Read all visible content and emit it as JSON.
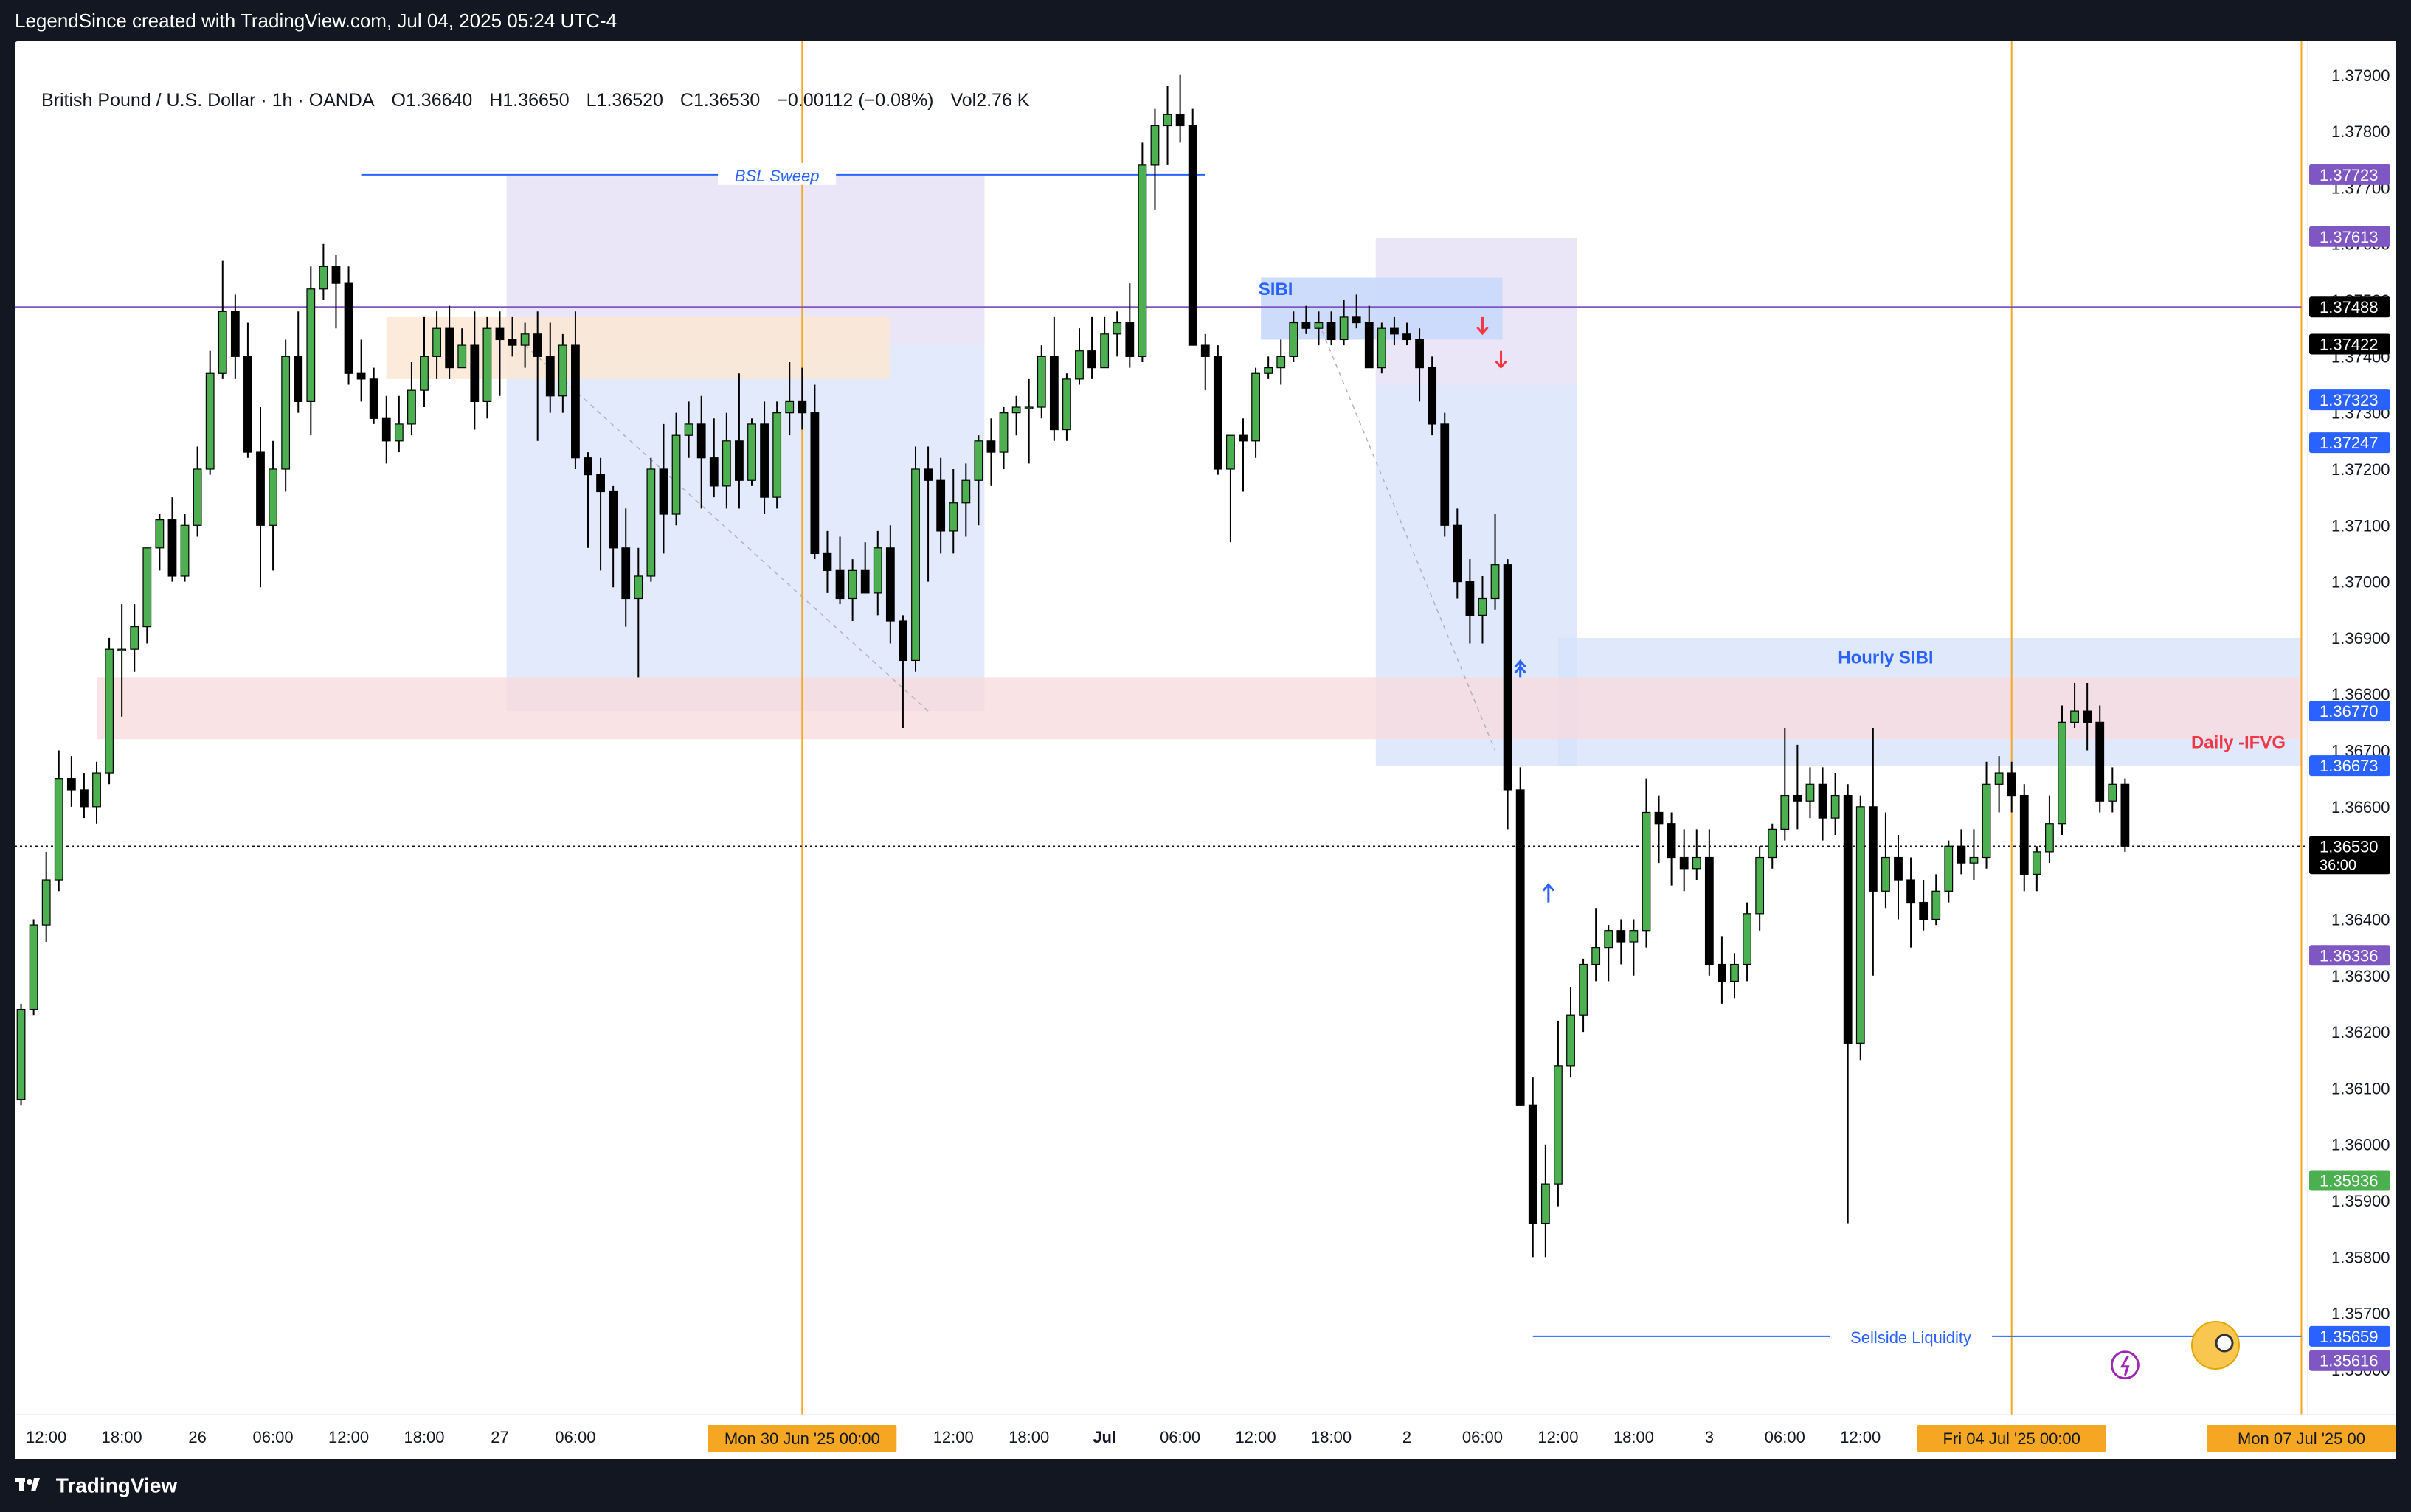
{
  "header": {
    "credit": "LegendSince created with TradingView.com, Jul 04, 2025 05:24 UTC-4"
  },
  "legend": {
    "symbol": "British Pound / U.S. Dollar · 1h · OANDA",
    "open": "O1.36640",
    "high": "H1.36650",
    "low": "L1.36520",
    "close": "C1.36530",
    "change": "−0.00112 (−0.08%)",
    "volume": "Vol2.76 K"
  },
  "footer": {
    "brand": "TradingView"
  },
  "colors": {
    "up": "#4caf50",
    "down": "#000000",
    "sibi_fill": "#d6e1fb",
    "purple_zone": "#ece6f6",
    "ifvg_fill": "#f8d9dc",
    "ob_fill": "#fbe7d3",
    "session_line": "#f5a623",
    "level_line": "#7e57c2",
    "blue_line": "#2962ff",
    "ifvg_text": "#f23645"
  },
  "chart_data": {
    "type": "candlestick",
    "title": "British Pound / U.S. Dollar · 1h · OANDA",
    "y_axis": {
      "range": [
        1.3552,
        1.3796
      ],
      "ticks": [
        "1.37900",
        "1.37800",
        "1.37700",
        "1.37600",
        "1.37500",
        "1.37400",
        "1.37300",
        "1.37200",
        "1.37100",
        "1.37000",
        "1.36900",
        "1.36800",
        "1.36700",
        "1.36600",
        "1.36500",
        "1.36400",
        "1.36300",
        "1.36200",
        "1.36100",
        "1.36000",
        "1.35900",
        "1.35800",
        "1.35700",
        "1.35600"
      ]
    },
    "x_axis": {
      "labels": [
        "12:00",
        "18:00",
        "26",
        "06:00",
        "12:00",
        "18:00",
        "27",
        "06:00",
        "12:00",
        "18:00",
        "Jul",
        "06:00",
        "12:00",
        "18:00",
        "2",
        "06:00",
        "12:00",
        "18:00",
        "3",
        "06:00",
        "12:00"
      ],
      "label_bars": [
        2,
        8,
        14,
        20,
        26,
        32,
        38,
        44,
        74,
        80,
        86,
        92,
        98,
        104,
        110,
        116,
        122,
        128,
        134,
        140,
        146
      ],
      "session_markers": [
        {
          "label": "Mon 30 Jun '25   00:00",
          "bar": 62
        },
        {
          "label": "Fri 04 Jul '25   00:00",
          "bar": 158
        },
        {
          "label": "Mon 07 Jul '25   00",
          "bar": 181
        }
      ]
    },
    "price_tags": [
      {
        "label": "1.37723",
        "value": 1.37723,
        "color": "#7e57c2"
      },
      {
        "label": "1.37613",
        "value": 1.37613,
        "color": "#7e57c2"
      },
      {
        "label": "1.37488",
        "value": 1.37488,
        "color": "#000000"
      },
      {
        "label": "1.37422",
        "value": 1.37422,
        "color": "#000000"
      },
      {
        "label": "1.37323",
        "value": 1.37323,
        "color": "#2962ff"
      },
      {
        "label": "1.37247",
        "value": 1.37247,
        "color": "#2962ff"
      },
      {
        "label": "1.36770",
        "value": 1.3677,
        "color": "#2962ff"
      },
      {
        "label": "1.36673",
        "value": 1.36673,
        "color": "#2962ff"
      },
      {
        "label": "1.36530",
        "value": 1.3653,
        "color": "#000000",
        "sub": "36:00"
      },
      {
        "label": "1.36336",
        "value": 1.36336,
        "color": "#7e57c2"
      },
      {
        "label": "1.35936",
        "value": 1.35936,
        "color": "#4caf50"
      },
      {
        "label": "1.35659",
        "value": 1.35659,
        "color": "#2962ff"
      },
      {
        "label": "1.35616",
        "value": 1.35616,
        "color": "#7e57c2"
      }
    ],
    "annotations": [
      {
        "text": "BSL Sweep",
        "price": 1.37723,
        "bar_from": 26,
        "bar_to": 90
      },
      {
        "text": "SIBI",
        "price": 1.3752,
        "bar": 99
      },
      {
        "text": "Hourly SIBI",
        "price": 1.36865,
        "bar": 148
      },
      {
        "text": "Daily -IFVG",
        "price": 1.36725,
        "bar": 181
      },
      {
        "text": "Sellside Liquidity",
        "price": 1.35659,
        "bar": 150
      }
    ],
    "candles": [
      [
        1.3608,
        1.3625,
        1.3607,
        1.3624
      ],
      [
        1.3624,
        1.364,
        1.3623,
        1.3639
      ],
      [
        1.3639,
        1.3652,
        1.3636,
        1.3647
      ],
      [
        1.3647,
        1.367,
        1.3645,
        1.3665
      ],
      [
        1.3665,
        1.3669,
        1.366,
        1.3663
      ],
      [
        1.3663,
        1.3666,
        1.3658,
        1.366
      ],
      [
        1.366,
        1.3668,
        1.3657,
        1.3666
      ],
      [
        1.3666,
        1.369,
        1.3664,
        1.3688
      ],
      [
        1.3688,
        1.3696,
        1.3676,
        1.3688
      ],
      [
        1.3688,
        1.3696,
        1.3684,
        1.3692
      ],
      [
        1.3692,
        1.3703,
        1.3689,
        1.3706
      ],
      [
        1.3706,
        1.3712,
        1.3702,
        1.3711
      ],
      [
        1.3711,
        1.3715,
        1.37,
        1.3701
      ],
      [
        1.3701,
        1.3712,
        1.37,
        1.371
      ],
      [
        1.371,
        1.3724,
        1.3708,
        1.372
      ],
      [
        1.372,
        1.3741,
        1.3719,
        1.3737
      ],
      [
        1.3737,
        1.3757,
        1.3736,
        1.3748
      ],
      [
        1.3748,
        1.3751,
        1.3736,
        1.374
      ],
      [
        1.374,
        1.3746,
        1.3722,
        1.3723
      ],
      [
        1.3723,
        1.3731,
        1.3699,
        1.371
      ],
      [
        1.371,
        1.3725,
        1.3702,
        1.372
      ],
      [
        1.372,
        1.3743,
        1.3716,
        1.374
      ],
      [
        1.374,
        1.3748,
        1.373,
        1.3732
      ],
      [
        1.3732,
        1.3756,
        1.3726,
        1.3752
      ],
      [
        1.3752,
        1.376,
        1.375,
        1.3756
      ],
      [
        1.3756,
        1.3758,
        1.3745,
        1.3753
      ],
      [
        1.3753,
        1.3756,
        1.3735,
        1.3737
      ],
      [
        1.3737,
        1.3743,
        1.3732,
        1.3736
      ],
      [
        1.3736,
        1.3738,
        1.3728,
        1.3729
      ],
      [
        1.3729,
        1.3733,
        1.3721,
        1.3725
      ],
      [
        1.3725,
        1.3733,
        1.3723,
        1.3728
      ],
      [
        1.3728,
        1.3739,
        1.3726,
        1.3734
      ],
      [
        1.3734,
        1.3747,
        1.3731,
        1.374
      ],
      [
        1.374,
        1.3748,
        1.3736,
        1.3745
      ],
      [
        1.3745,
        1.3749,
        1.3736,
        1.3738
      ],
      [
        1.3738,
        1.3745,
        1.3738,
        1.3742
      ],
      [
        1.3742,
        1.3748,
        1.3727,
        1.3732
      ],
      [
        1.3732,
        1.3747,
        1.3729,
        1.3745
      ],
      [
        1.3745,
        1.3748,
        1.3733,
        1.3743
      ],
      [
        1.3743,
        1.3747,
        1.374,
        1.3742
      ],
      [
        1.3742,
        1.3746,
        1.3738,
        1.3744
      ],
      [
        1.3744,
        1.3748,
        1.3725,
        1.374
      ],
      [
        1.374,
        1.3746,
        1.373,
        1.3733
      ],
      [
        1.3733,
        1.3744,
        1.373,
        1.3742
      ],
      [
        1.3742,
        1.3748,
        1.372,
        1.3722
      ],
      [
        1.3722,
        1.3723,
        1.3706,
        1.3719
      ],
      [
        1.3719,
        1.3722,
        1.3702,
        1.3716
      ],
      [
        1.3716,
        1.3717,
        1.3699,
        1.3706
      ],
      [
        1.3706,
        1.3713,
        1.3692,
        1.3697
      ],
      [
        1.3697,
        1.3706,
        1.3683,
        1.3701
      ],
      [
        1.3701,
        1.3722,
        1.37,
        1.372
      ],
      [
        1.372,
        1.3728,
        1.3705,
        1.3712
      ],
      [
        1.3712,
        1.373,
        1.371,
        1.3726
      ],
      [
        1.3726,
        1.3732,
        1.3722,
        1.3728
      ],
      [
        1.3728,
        1.3733,
        1.3713,
        1.3722
      ],
      [
        1.3722,
        1.3729,
        1.3715,
        1.3717
      ],
      [
        1.3717,
        1.373,
        1.3713,
        1.3725
      ],
      [
        1.3725,
        1.3737,
        1.3713,
        1.3718
      ],
      [
        1.3718,
        1.3729,
        1.3717,
        1.3728
      ],
      [
        1.3728,
        1.3732,
        1.3712,
        1.3715
      ],
      [
        1.3715,
        1.3732,
        1.3713,
        1.373
      ],
      [
        1.373,
        1.3739,
        1.3726,
        1.3732
      ],
      [
        1.3732,
        1.3738,
        1.3727,
        1.373
      ],
      [
        1.373,
        1.3735,
        1.3704,
        1.3705
      ],
      [
        1.3705,
        1.3709,
        1.3698,
        1.3702
      ],
      [
        1.3702,
        1.3708,
        1.3696,
        1.3697
      ],
      [
        1.3697,
        1.3704,
        1.3693,
        1.3702
      ],
      [
        1.3702,
        1.3707,
        1.3699,
        1.3698
      ],
      [
        1.3698,
        1.3709,
        1.3694,
        1.3706
      ],
      [
        1.3706,
        1.371,
        1.3689,
        1.3693
      ],
      [
        1.3693,
        1.3694,
        1.3674,
        1.3686
      ],
      [
        1.3686,
        1.3724,
        1.3684,
        1.372
      ],
      [
        1.372,
        1.3724,
        1.37,
        1.3718
      ],
      [
        1.3718,
        1.3722,
        1.3705,
        1.3709
      ],
      [
        1.3709,
        1.372,
        1.3705,
        1.3714
      ],
      [
        1.3714,
        1.3721,
        1.3708,
        1.3718
      ],
      [
        1.3718,
        1.3726,
        1.371,
        1.3725
      ],
      [
        1.3725,
        1.3729,
        1.3717,
        1.3723
      ],
      [
        1.3723,
        1.3731,
        1.372,
        1.373
      ],
      [
        1.373,
        1.3733,
        1.3726,
        1.3731
      ],
      [
        1.3731,
        1.3736,
        1.3721,
        1.3731
      ],
      [
        1.3731,
        1.3742,
        1.3729,
        1.374
      ],
      [
        1.374,
        1.3747,
        1.3725,
        1.3727
      ],
      [
        1.3727,
        1.3737,
        1.3725,
        1.3736
      ],
      [
        1.3736,
        1.3745,
        1.3735,
        1.3741
      ],
      [
        1.3741,
        1.3747,
        1.3736,
        1.3738
      ],
      [
        1.3738,
        1.3747,
        1.3738,
        1.3744
      ],
      [
        1.3744,
        1.3748,
        1.374,
        1.3746
      ],
      [
        1.3746,
        1.3753,
        1.3738,
        1.374
      ],
      [
        1.374,
        1.3778,
        1.3739,
        1.3774
      ],
      [
        1.3774,
        1.3784,
        1.3766,
        1.3781
      ],
      [
        1.3781,
        1.3788,
        1.3774,
        1.3783
      ],
      [
        1.3783,
        1.379,
        1.3778,
        1.3781
      ],
      [
        1.3781,
        1.3784,
        1.3748,
        1.3742
      ],
      [
        1.3742,
        1.3744,
        1.3734,
        1.374
      ],
      [
        1.374,
        1.3742,
        1.3719,
        1.372
      ],
      [
        1.372,
        1.3724,
        1.3707,
        1.3726
      ],
      [
        1.3726,
        1.3729,
        1.3716,
        1.3725
      ],
      [
        1.3725,
        1.3738,
        1.3722,
        1.3737
      ],
      [
        1.3737,
        1.374,
        1.3736,
        1.3738
      ],
      [
        1.3738,
        1.3743,
        1.3735,
        1.374
      ],
      [
        1.374,
        1.3748,
        1.3739,
        1.3746
      ],
      [
        1.3746,
        1.3749,
        1.3744,
        1.3745
      ],
      [
        1.3745,
        1.3748,
        1.3742,
        1.3746
      ],
      [
        1.3746,
        1.3748,
        1.3742,
        1.3743
      ],
      [
        1.3743,
        1.375,
        1.3742,
        1.3747
      ],
      [
        1.3747,
        1.3751,
        1.3745,
        1.3746
      ],
      [
        1.3746,
        1.3749,
        1.374,
        1.3738
      ],
      [
        1.3738,
        1.3746,
        1.3737,
        1.3745
      ],
      [
        1.3745,
        1.3747,
        1.3742,
        1.3744
      ],
      [
        1.3744,
        1.3746,
        1.3742,
        1.3743
      ],
      [
        1.3743,
        1.3745,
        1.3732,
        1.3738
      ],
      [
        1.3738,
        1.374,
        1.3726,
        1.3728
      ],
      [
        1.3728,
        1.373,
        1.3708,
        1.371
      ],
      [
        1.371,
        1.3713,
        1.3697,
        1.37
      ],
      [
        1.37,
        1.3704,
        1.3689,
        1.3694
      ],
      [
        1.3694,
        1.3701,
        1.3689,
        1.3697
      ],
      [
        1.3697,
        1.3712,
        1.3695,
        1.3703
      ],
      [
        1.3703,
        1.3704,
        1.3656,
        1.3663
      ],
      [
        1.3663,
        1.3667,
        1.361,
        1.3607
      ],
      [
        1.3607,
        1.3612,
        1.358,
        1.3586
      ],
      [
        1.3586,
        1.36,
        1.358,
        1.3593
      ],
      [
        1.3593,
        1.3622,
        1.3589,
        1.3614
      ],
      [
        1.3614,
        1.3628,
        1.3612,
        1.3623
      ],
      [
        1.3623,
        1.3633,
        1.362,
        1.3632
      ],
      [
        1.3632,
        1.3642,
        1.3629,
        1.3635
      ],
      [
        1.3635,
        1.3639,
        1.3629,
        1.3638
      ],
      [
        1.3638,
        1.364,
        1.3632,
        1.3636
      ],
      [
        1.3636,
        1.364,
        1.363,
        1.3638
      ],
      [
        1.3638,
        1.3665,
        1.3635,
        1.3659
      ],
      [
        1.3659,
        1.3662,
        1.365,
        1.3657
      ],
      [
        1.3657,
        1.3659,
        1.3646,
        1.3651
      ],
      [
        1.3651,
        1.3656,
        1.3645,
        1.3649
      ],
      [
        1.3649,
        1.3656,
        1.3647,
        1.3651
      ],
      [
        1.3651,
        1.3656,
        1.363,
        1.3632
      ],
      [
        1.3632,
        1.3637,
        1.3625,
        1.3629
      ],
      [
        1.3629,
        1.3634,
        1.3626,
        1.3632
      ],
      [
        1.3632,
        1.3643,
        1.3629,
        1.3641
      ],
      [
        1.3641,
        1.3653,
        1.3638,
        1.3651
      ],
      [
        1.3651,
        1.3657,
        1.3649,
        1.3656
      ],
      [
        1.3656,
        1.3674,
        1.3654,
        1.3662
      ],
      [
        1.3662,
        1.3671,
        1.3656,
        1.3661
      ],
      [
        1.3661,
        1.3667,
        1.3658,
        1.3664
      ],
      [
        1.3664,
        1.3667,
        1.3654,
        1.3658
      ],
      [
        1.3658,
        1.3666,
        1.3655,
        1.3662
      ],
      [
        1.3662,
        1.3664,
        1.3586,
        1.3618
      ],
      [
        1.3618,
        1.3662,
        1.3615,
        1.366
      ],
      [
        1.366,
        1.3674,
        1.363,
        1.3645
      ],
      [
        1.3645,
        1.3659,
        1.3642,
        1.3651
      ],
      [
        1.3651,
        1.3655,
        1.364,
        1.3647
      ],
      [
        1.3647,
        1.3651,
        1.3635,
        1.3643
      ],
      [
        1.3643,
        1.3647,
        1.3638,
        1.364
      ],
      [
        1.364,
        1.3648,
        1.3639,
        1.3645
      ],
      [
        1.3645,
        1.3654,
        1.3643,
        1.3653
      ],
      [
        1.3653,
        1.3656,
        1.3648,
        1.365
      ],
      [
        1.365,
        1.3656,
        1.3647,
        1.3651
      ],
      [
        1.3651,
        1.3668,
        1.3649,
        1.3664
      ],
      [
        1.3664,
        1.3669,
        1.3659,
        1.3666
      ],
      [
        1.3666,
        1.3668,
        1.3659,
        1.3662
      ],
      [
        1.3662,
        1.3664,
        1.3645,
        1.3648
      ],
      [
        1.3648,
        1.3653,
        1.3645,
        1.3652
      ],
      [
        1.3652,
        1.3662,
        1.365,
        1.3657
      ],
      [
        1.3657,
        1.3678,
        1.3655,
        1.3675
      ],
      [
        1.3675,
        1.3682,
        1.3674,
        1.3677
      ],
      [
        1.3677,
        1.3682,
        1.367,
        1.3675
      ],
      [
        1.3675,
        1.3678,
        1.3659,
        1.3661
      ],
      [
        1.3661,
        1.3667,
        1.3659,
        1.3664
      ],
      [
        1.3664,
        1.3665,
        1.3652,
        1.3653
      ]
    ]
  }
}
